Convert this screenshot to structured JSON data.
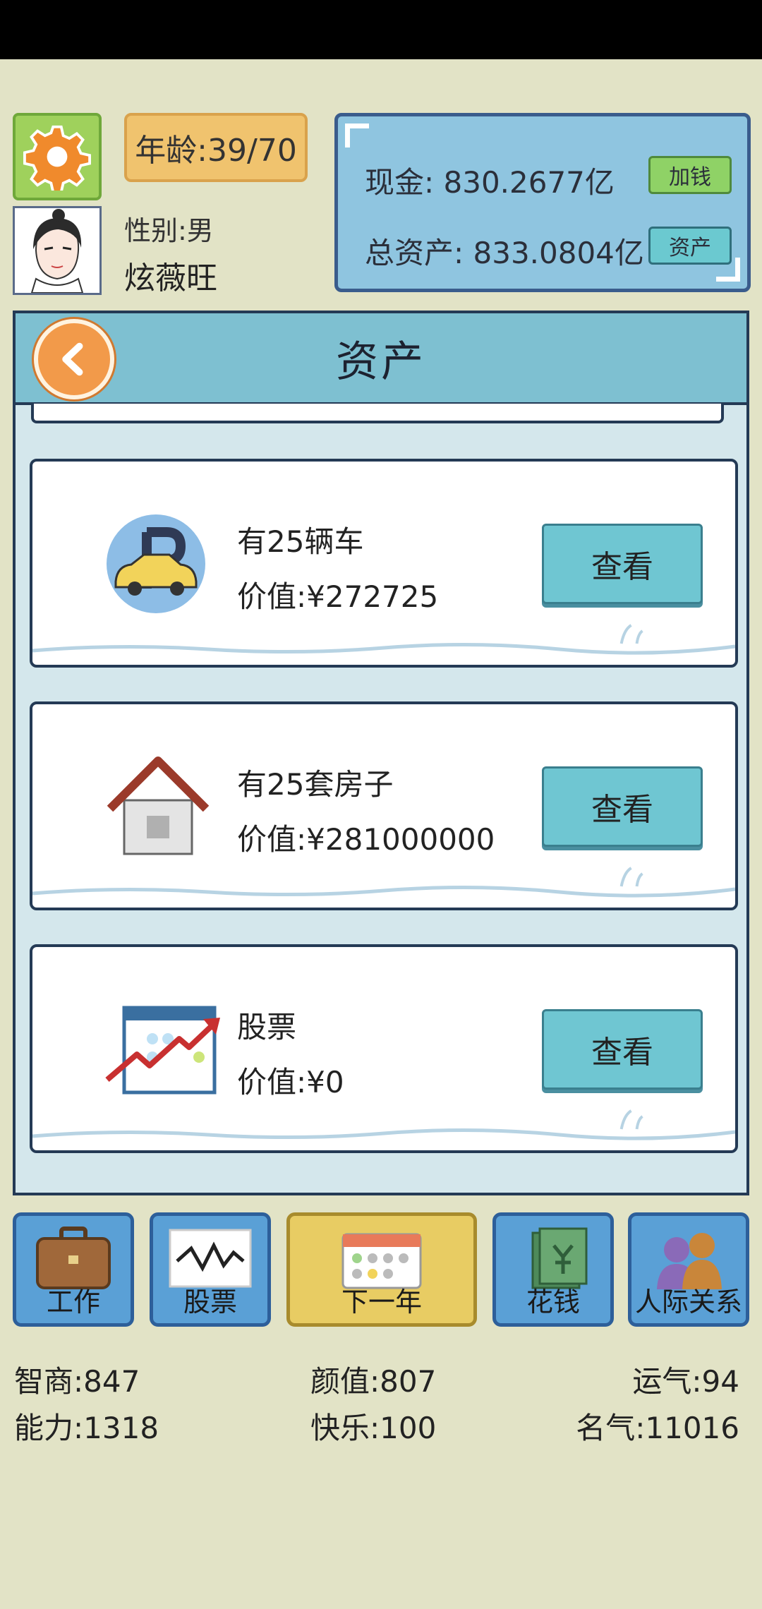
{
  "header": {
    "age_label": "年龄:39/70",
    "gender_label": "性别:男",
    "player_name": "炫薇旺",
    "cash_label": "现金: 830.2677亿",
    "total_assets_label": "总资产: 833.0804亿",
    "add_money_button": "加钱",
    "assets_button": "资产"
  },
  "panel": {
    "title": "资产",
    "items": [
      {
        "name": "有25辆车",
        "value": "价值:¥272725",
        "button": "查看",
        "icon": "car-parking-icon"
      },
      {
        "name": "有25套房子",
        "value": "价值:¥281000000",
        "button": "查看",
        "icon": "house-icon"
      },
      {
        "name": "股票",
        "value": "价值:¥0",
        "button": "查看",
        "icon": "stock-chart-icon"
      }
    ]
  },
  "nav": [
    {
      "label": "工作",
      "icon": "briefcase-icon"
    },
    {
      "label": "股票",
      "icon": "stock-graph-icon"
    },
    {
      "label": "下一年",
      "icon": "calendar-icon"
    },
    {
      "label": "花钱",
      "icon": "money-icon"
    },
    {
      "label": "人际关系",
      "icon": "people-icon"
    }
  ],
  "stats": {
    "iq": "智商:847",
    "looks": "颜值:807",
    "luck": "运气:94",
    "ability": "能力:1318",
    "happiness": "快乐:100",
    "fame": "名气:11016"
  },
  "colors": {
    "background": "#e2e3c6",
    "panel_header": "#7ec0d1",
    "view_button": "#6fc6d2",
    "nav_button": "#5aa0d6",
    "next_year_button": "#e8cc63"
  }
}
